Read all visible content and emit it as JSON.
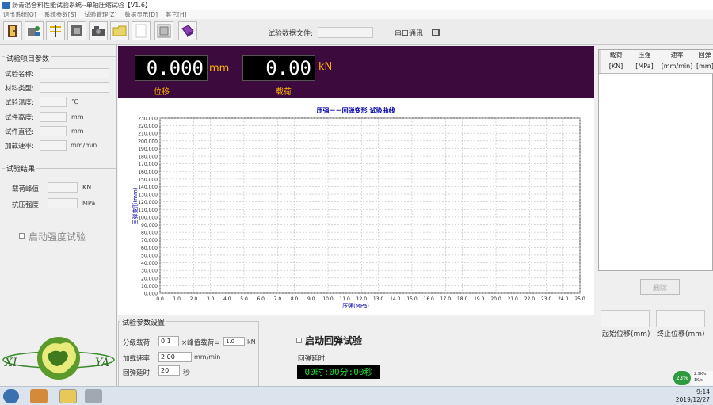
{
  "window": {
    "title": "沥青混合料性能试验系统--单轴压缩试验【V1.6】"
  },
  "menu": [
    "退出系统[Q]",
    "系统参数[S]",
    "试验管理[Z]",
    "数据显示[D]",
    "其它[H]"
  ],
  "toolbar": {
    "file_label": "试验数据文件:",
    "file_value": "",
    "serial_label": "串口通讯"
  },
  "left": {
    "params_title": "试验项目参数",
    "fields": [
      {
        "label": "试验名称:",
        "value": "",
        "unit": ""
      },
      {
        "label": "材料类型:",
        "value": "",
        "unit": ""
      },
      {
        "label": "试验温度:",
        "value": "",
        "unit": "℃"
      },
      {
        "label": "试件高度:",
        "value": "",
        "unit": "mm"
      },
      {
        "label": "试件直径:",
        "value": "",
        "unit": "mm"
      },
      {
        "label": "加载速率:",
        "value": "",
        "unit": "mm/min"
      }
    ],
    "results_title": "试验结果",
    "results": [
      {
        "label": "载荷峰值:",
        "value": "",
        "unit": "KN"
      },
      {
        "label": "抗压强度:",
        "value": "",
        "unit": "MPa"
      }
    ],
    "strength_label": "启动强度试验",
    "logo_left": "XI",
    "logo_right": "YA"
  },
  "display": {
    "disp_value": "0.000",
    "disp_unit": "mm",
    "disp_caption": "位移",
    "load_value": "0.00",
    "load_unit": "kN",
    "load_caption": "载荷"
  },
  "chart_data": {
    "type": "line",
    "title": "压强－－回弹变形  试验曲线",
    "xlabel": "压强(MPa)",
    "ylabel": "回弹变形(mm)",
    "xlim": [
      0,
      25
    ],
    "ylim": [
      0,
      230
    ],
    "xticks": [
      "0.0",
      "1.0",
      "2.0",
      "3.0",
      "4.0",
      "5.0",
      "6.0",
      "7.0",
      "8.0",
      "9.0",
      "10.0",
      "11.0",
      "12.0",
      "13.0",
      "14.0",
      "15.0",
      "16.0",
      "17.0",
      "18.0",
      "19.0",
      "20.0",
      "21.0",
      "22.0",
      "23.0",
      "24.0",
      "25.0"
    ],
    "yticks": [
      "0.000",
      "10.000",
      "20.000",
      "30.000",
      "40.000",
      "50.000",
      "60.000",
      "70.000",
      "80.000",
      "90.000",
      "100.000",
      "110.000",
      "120.000",
      "130.000",
      "140.000",
      "150.000",
      "160.000",
      "170.000",
      "180.000",
      "190.000",
      "200.000",
      "210.000",
      "220.000",
      "230.000"
    ],
    "grid": true,
    "series": []
  },
  "settings": {
    "title": "试验参数设置",
    "step_label": "分级载荷:",
    "step_value": "0.1",
    "step_mid": "×峰值载荷=",
    "step_result": "1.0",
    "step_unit": "kN",
    "rate_label": "加载速率:",
    "rate_value": "2.00",
    "rate_unit": "mm/min",
    "delay_label": "回弹延时:",
    "delay_value": "20",
    "delay_unit": "秒",
    "rebound_label": "启动回弹试验",
    "rebound_delay_label": "回弹延时:",
    "timer": "00时:00分:00秒"
  },
  "right": {
    "columns": [
      {
        "name": "载荷",
        "unit": "[KN]"
      },
      {
        "name": "压强",
        "unit": "[MPa]"
      },
      {
        "name": "速率",
        "unit": "[mm/min]"
      },
      {
        "name": "回弹",
        "unit": "[mm]"
      }
    ],
    "delete_label": "删除",
    "start_pos_label": "起始位移(mm)",
    "end_pos_label": "终止位移(mm)"
  },
  "taskbar": {
    "time": "9:14",
    "date": "2019/12/27",
    "battery": "23%",
    "net_up": "2.9K/s",
    "net_down": "1K/s"
  }
}
